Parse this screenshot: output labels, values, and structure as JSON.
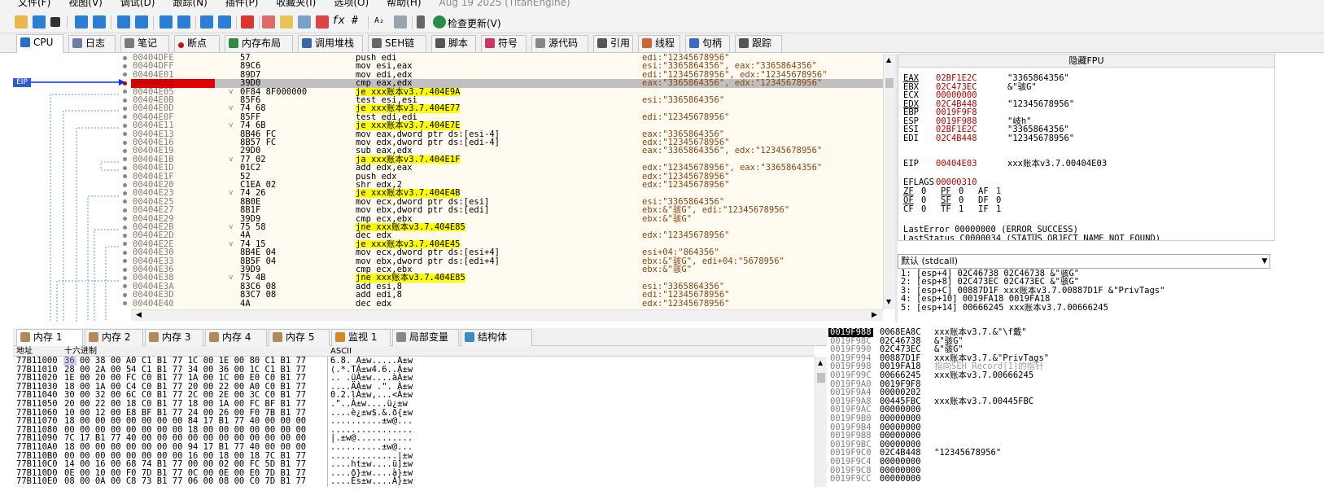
{
  "menu": [
    "文件(F)",
    "视图(V)",
    "调试(D)",
    "跟踪(N)",
    "插件(P)",
    "收藏夹(I)",
    "选项(O)",
    "帮助(H)",
    "Aug 19 2025 (TitanEngine)"
  ],
  "toolbar": {
    "update_label": "检查更新(V)"
  },
  "tabs": [
    "CPU",
    "日志",
    "笔记",
    "断点",
    "内存布局",
    "调用堆栈",
    "SEH链",
    "脚本",
    "符号",
    "源代码",
    "引用",
    "线程",
    "句柄",
    "跟踪"
  ],
  "eip_label": "EIP",
  "disasm": [
    {
      "addr": "00404DFE",
      "bytes": "57",
      "arrow": "",
      "ins": "push edi",
      "cm": "edi:\"12345678956\""
    },
    {
      "addr": "00404DFF",
      "bytes": "89C6",
      "arrow": "",
      "ins": "mov esi,eax",
      "cm": "esi:\"3365864356\", eax:\"3365864356\""
    },
    {
      "addr": "00404E01",
      "bytes": "89D7",
      "arrow": "",
      "ins": "mov edi,edx",
      "cm": "edi:\"12345678956\", edx:\"12345678956\""
    },
    {
      "addr": "00404E03",
      "bytes": "39D0",
      "arrow": "",
      "ins": "cmp eax,edx",
      "cm": "eax:\"3365864356\", edx:\"12345678956\"",
      "cur": true
    },
    {
      "addr": "00404E05",
      "bytes": "0F84 8F000000",
      "arrow": "v",
      "ins": "je xxx账本v3.7.404E9A",
      "cm": "",
      "jump": true
    },
    {
      "addr": "00404E0B",
      "bytes": "85F6",
      "arrow": "",
      "ins": "test esi,esi",
      "cm": "esi:\"3365864356\""
    },
    {
      "addr": "00404E0D",
      "bytes": "74 68",
      "arrow": "v",
      "ins": "je xxx账本v3.7.404E77",
      "cm": "",
      "jump": true
    },
    {
      "addr": "00404E0F",
      "bytes": "85FF",
      "arrow": "",
      "ins": "test edi,edi",
      "cm": "edi:\"12345678956\""
    },
    {
      "addr": "00404E11",
      "bytes": "74 6B",
      "arrow": "v",
      "ins": "je xxx账本v3.7.404E7E",
      "cm": "",
      "jump": true
    },
    {
      "addr": "00404E13",
      "bytes": "8B46 FC",
      "arrow": "",
      "ins": "mov eax,dword ptr ds:[esi-4]",
      "cm": "eax:\"3365864356\""
    },
    {
      "addr": "00404E16",
      "bytes": "8B57 FC",
      "arrow": "",
      "ins": "mov edx,dword ptr ds:[edi-4]",
      "cm": "edx:\"12345678956\""
    },
    {
      "addr": "00404E19",
      "bytes": "29D0",
      "arrow": "",
      "ins": "sub eax,edx",
      "cm": "eax:\"3365864356\", edx:\"12345678956\""
    },
    {
      "addr": "00404E1B",
      "bytes": "77 02",
      "arrow": "v",
      "ins": "ja xxx账本v3.7.404E1F",
      "cm": "",
      "jump": true
    },
    {
      "addr": "00404E1D",
      "bytes": "01C2",
      "arrow": "",
      "ins": "add edx,eax",
      "cm": "edx:\"12345678956\", eax:\"3365864356\""
    },
    {
      "addr": "00404E1F",
      "bytes": "52",
      "arrow": "",
      "ins": "push edx",
      "cm": "edx:\"12345678956\""
    },
    {
      "addr": "00404E20",
      "bytes": "C1EA 02",
      "arrow": "",
      "ins": "shr edx,2",
      "cm": "edx:\"12345678956\""
    },
    {
      "addr": "00404E23",
      "bytes": "74 26",
      "arrow": "v",
      "ins": "je xxx账本v3.7.404E4B",
      "cm": "",
      "jump": true
    },
    {
      "addr": "00404E25",
      "bytes": "8B0E",
      "arrow": "",
      "ins": "mov ecx,dword ptr ds:[esi]",
      "cm": "esi:\"3365864356\""
    },
    {
      "addr": "00404E27",
      "bytes": "8B1F",
      "arrow": "",
      "ins": "mov ebx,dword ptr ds:[edi]",
      "cm": "ebx:&\"骇G\", edi:\"12345678956\""
    },
    {
      "addr": "00404E29",
      "bytes": "39D9",
      "arrow": "",
      "ins": "cmp ecx,ebx",
      "cm": "ebx:&\"骇G\""
    },
    {
      "addr": "00404E2B",
      "bytes": "75 58",
      "arrow": "v",
      "ins": "jne xxx账本v3.7.404E85",
      "cm": "",
      "jump": true
    },
    {
      "addr": "00404E2D",
      "bytes": "4A",
      "arrow": "",
      "ins": "dec edx",
      "cm": "edx:\"12345678956\""
    },
    {
      "addr": "00404E2E",
      "bytes": "74 15",
      "arrow": "v",
      "ins": "je xxx账本v3.7.404E45",
      "cm": "",
      "jump": true
    },
    {
      "addr": "00404E30",
      "bytes": "8B4E 04",
      "arrow": "",
      "ins": "mov ecx,dword ptr ds:[esi+4]",
      "cm": "esi+04:\"864356\""
    },
    {
      "addr": "00404E33",
      "bytes": "8B5F 04",
      "arrow": "",
      "ins": "mov ebx,dword ptr ds:[edi+4]",
      "cm": "ebx:&\"骇G\", edi+04:\"5678956\""
    },
    {
      "addr": "00404E36",
      "bytes": "39D9",
      "arrow": "",
      "ins": "cmp ecx,ebx",
      "cm": "ebx:&\"骇G\""
    },
    {
      "addr": "00404E38",
      "bytes": "75 4B",
      "arrow": "v",
      "ins": "jne xxx账本v3.7.404E85",
      "cm": "",
      "jump": true
    },
    {
      "addr": "00404E3A",
      "bytes": "83C6 08",
      "arrow": "",
      "ins": "add esi,8",
      "cm": "esi:\"3365864356\""
    },
    {
      "addr": "00404E3D",
      "bytes": "83C7 08",
      "arrow": "",
      "ins": "add edi,8",
      "cm": "edi:\"12345678956\""
    },
    {
      "addr": "00404E40",
      "bytes": "4A",
      "arrow": "",
      "ins": "dec edx",
      "cm": "edx:\"12345678956\""
    }
  ],
  "regs": {
    "header": "隐藏FPU",
    "list": [
      {
        "n": "EAX",
        "v": "02BF1E2C",
        "c": "\"3365864356\"",
        "u": true
      },
      {
        "n": "EBX",
        "v": "02C473EC",
        "c": "&\"骇G\""
      },
      {
        "n": "ECX",
        "v": "00000000",
        "c": ""
      },
      {
        "n": "EDX",
        "v": "02C4B448",
        "c": "\"12345678956\"",
        "u": true
      },
      {
        "n": "EBP",
        "v": "0019F9F8",
        "c": ""
      },
      {
        "n": "ESP",
        "v": "0019F988",
        "c": "\"岐h\""
      },
      {
        "n": "ESI",
        "v": "02BF1E2C",
        "c": "\"3365864356\""
      },
      {
        "n": "EDI",
        "v": "02C4B448",
        "c": "\"12345678956\""
      }
    ],
    "eip": {
      "n": "EIP",
      "v": "00404E03",
      "c": "xxx账本v3.7.00404E03"
    },
    "eflags": {
      "n": "EFLAGS",
      "v": "00000310"
    },
    "flags": [
      [
        {
          "n": "ZF",
          "v": "0"
        },
        {
          "n": "PF",
          "v": "0"
        },
        {
          "n": "AF",
          "v": "1"
        }
      ],
      [
        {
          "n": "OF",
          "v": "0"
        },
        {
          "n": "SF",
          "v": "0"
        },
        {
          "n": "DF",
          "v": "0"
        }
      ],
      [
        {
          "n": "CF",
          "v": "0"
        },
        {
          "n": "TF",
          "v": "1"
        },
        {
          "n": "IF",
          "v": "1"
        }
      ]
    ],
    "lasterror": "LastError  00000000 (ERROR_SUCCESS)",
    "laststatus": "LastStatus C0000034 (STATUS_OBJECT_NAME_NOT_FOUND)"
  },
  "callconv": "默认 (stdcall)",
  "args": [
    "1: [esp+4] 02C46738 02C46738 &\"骇G\"",
    "2: [esp+8] 02C473EC 02C473EC &\"骇G\"",
    "3: [esp+C] 00887D1F xxx账本v3.7.00887D1F &\"PrivTags\"",
    "4: [esp+10] 0019FA18 0019FA18",
    "5: [esp+14] 00666245 xxx账本v3.7.00666245"
  ],
  "memtabs": [
    "内存 1",
    "内存 2",
    "内存 3",
    "内存 4",
    "内存 5",
    "监视 1",
    "局部变量",
    "结构体"
  ],
  "memhdr": {
    "addr": "地址",
    "hex": "十六进制",
    "ascii": "ASCII"
  },
  "dump": [
    {
      "a": "77B11000",
      "h": "36 00 38 00 A0 C1 B1 77 1C 00 1E 00 80 C1 B1 77",
      "c": "6.8. Á±w.....Á±w"
    },
    {
      "a": "77B11010",
      "h": "28 00 2A 00 54 C1 B1 77 34 00 36 00 1C C1 B1 77",
      "c": "(.*.TÁ±w4.6..Á±w"
    },
    {
      "a": "77B11020",
      "h": "1E 00 20 00 FC C0 B1 77 1A 00 1C 00 E0 C0 B1 77",
      "c": ".. .üÀ±w....àÀ±w"
    },
    {
      "a": "77B11030",
      "h": "18 00 1A 00 C4 C0 B1 77 20 00 22 00 A0 C0 B1 77",
      "c": "....ÄÀ±w .\". À±w"
    },
    {
      "a": "77B11040",
      "h": "30 00 32 00 6C C0 B1 77 2C 00 2E 00 3C C0 B1 77",
      "c": "0.2.lÀ±w,...<À±w"
    },
    {
      "a": "77B11050",
      "h": "20 00 22 00 18 C0 B1 77 18 00 1A 00 FC BF B1 77",
      "c": " .\"..À±w....ü¿±w"
    },
    {
      "a": "77B11060",
      "h": "10 00 12 00 E8 BF B1 77 24 00 26 00 F0 7B B1 77",
      "c": "....è¿±w$.&.ð{±w"
    },
    {
      "a": "77B11070",
      "h": "18 00 00 00 00 00 00 00 84 17 B1 77 40 00 00 00",
      "c": "..........±w@..."
    },
    {
      "a": "77B11080",
      "h": "00 00 00 00 00 00 00 00 18 00 00 00 00 00 00 00",
      "c": "................"
    },
    {
      "a": "77B11090",
      "h": "7C 17 B1 77 40 00 00 00 00 00 00 00 00 00 00 00",
      "c": "|.±w@..........."
    },
    {
      "a": "77B110A0",
      "h": "18 00 00 00 00 00 00 00 94 17 B1 77 40 00 00 00",
      "c": "..........±w@..."
    },
    {
      "a": "77B110B0",
      "h": "00 00 00 00 00 00 00 00 16 00 18 00 18 7C B1 77",
      "c": ".............|±w"
    },
    {
      "a": "77B110C0",
      "h": "14 00 16 00 68 74 B1 77 00 00 02 00 FC 5D B1 77",
      "c": "....ht±w....ü]±w"
    },
    {
      "a": "77B110D0",
      "h": "0E 00 10 00 F0 7D B1 77 0C 00 0E 00 E0 7D B1 77",
      "c": "....ð}±w....à}±w"
    },
    {
      "a": "77B110E0",
      "h": "08 00 0A 00 C8 73 B1 77 06 00 08 00 C0 7D B1 77",
      "c": "....Ès±w....À}±w"
    }
  ],
  "stack": [
    {
      "a": "0019F988",
      "v": "0068EA8C",
      "c": "xxx账本v3.7.&\"\\f戴\"",
      "top": true
    },
    {
      "a": "0019F98C",
      "v": "02C46738",
      "c": "&\"骇G\""
    },
    {
      "a": "0019F990",
      "v": "02C473EC",
      "c": "&\"骇G\""
    },
    {
      "a": "0019F994",
      "v": "00887D1F",
      "c": "xxx账本v3.7.&\"PrivTags\""
    },
    {
      "a": "0019F998",
      "v": "0019FA18",
      "c": "指向SEH_Record[1]的指针",
      "seh": true
    },
    {
      "a": "0019F99C",
      "v": "00666245",
      "c": "xxx账本v3.7.00666245"
    },
    {
      "a": "0019F9A0",
      "v": "0019F9F8",
      "c": ""
    },
    {
      "a": "0019F9A4",
      "v": "00000202",
      "c": ""
    },
    {
      "a": "0019F9A8",
      "v": "00445FBC",
      "c": "xxx账本v3.7.00445FBC"
    },
    {
      "a": "0019F9AC",
      "v": "00000000",
      "c": ""
    },
    {
      "a": "0019F9B0",
      "v": "00000000",
      "c": ""
    },
    {
      "a": "0019F9B4",
      "v": "00000000",
      "c": ""
    },
    {
      "a": "0019F9B8",
      "v": "00000000",
      "c": ""
    },
    {
      "a": "0019F9BC",
      "v": "00000000",
      "c": ""
    },
    {
      "a": "0019F9C0",
      "v": "02C4B448",
      "c": "\"12345678956\""
    },
    {
      "a": "0019F9C4",
      "v": "00000000",
      "c": ""
    },
    {
      "a": "0019F9C8",
      "v": "00000000",
      "c": ""
    },
    {
      "a": "0019F9CC",
      "v": "00000000",
      "c": ""
    }
  ]
}
